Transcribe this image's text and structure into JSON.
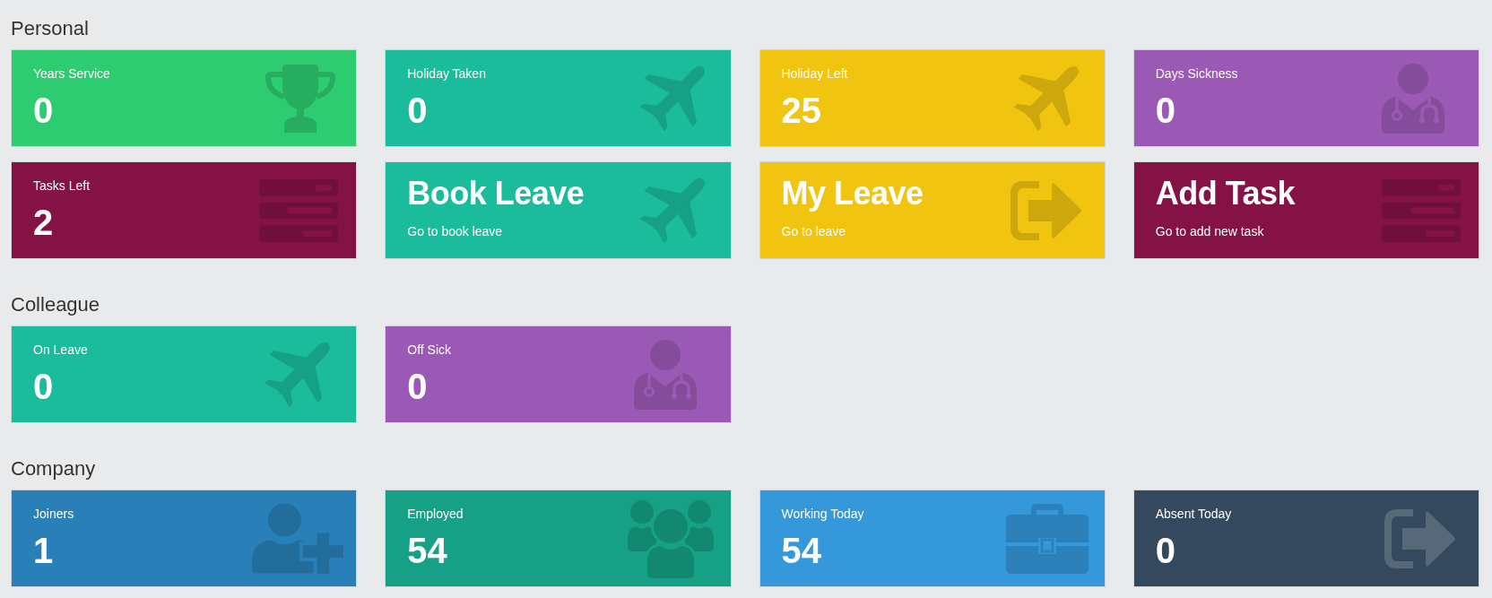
{
  "sections": [
    {
      "title": "Personal",
      "cards": [
        {
          "kind": "service",
          "label": "Years Service",
          "value": "0",
          "color": "#2ecc71"
        },
        {
          "kind": "leave",
          "label": "Holiday Taken",
          "value": "0",
          "color": "#1abc9c"
        },
        {
          "kind": "leave",
          "label": "Holiday Left",
          "value": "25",
          "color": "#f1c40f"
        },
        {
          "kind": "sickness",
          "label": "Days Sickness",
          "value": "0",
          "color": "#9b59b6"
        },
        {
          "kind": "tasks",
          "label": "Tasks Left",
          "value": "2",
          "color": "#851245"
        },
        {
          "kind": "leave",
          "title": "Book Leave",
          "subtitle": "Go to book leave",
          "color": "#1abc9c"
        },
        {
          "kind": "absence",
          "title": "My Leave",
          "subtitle": "Go to leave",
          "color": "#f1c40f"
        },
        {
          "kind": "tasks",
          "title": "Add Task",
          "subtitle": "Go to add new task",
          "color": "#851245"
        }
      ]
    },
    {
      "title": "Colleague",
      "cards": [
        {
          "kind": "leave",
          "label": "On Leave",
          "value": "0",
          "color": "#1abc9c"
        },
        {
          "kind": "sickness",
          "label": "Off Sick",
          "value": "0",
          "color": "#9b59b6"
        }
      ]
    },
    {
      "title": "Company",
      "cards": [
        {
          "kind": "joiners",
          "label": "Joiners",
          "value": "1",
          "color": "#2980b9"
        },
        {
          "kind": "staff",
          "label": "Employed",
          "value": "54",
          "color": "#16a085"
        },
        {
          "kind": "work",
          "label": "Working Today",
          "value": "54",
          "color": "#3498db"
        },
        {
          "kind": "absence",
          "label": "Absent Today",
          "value": "0",
          "color": "#34495e"
        }
      ]
    }
  ]
}
